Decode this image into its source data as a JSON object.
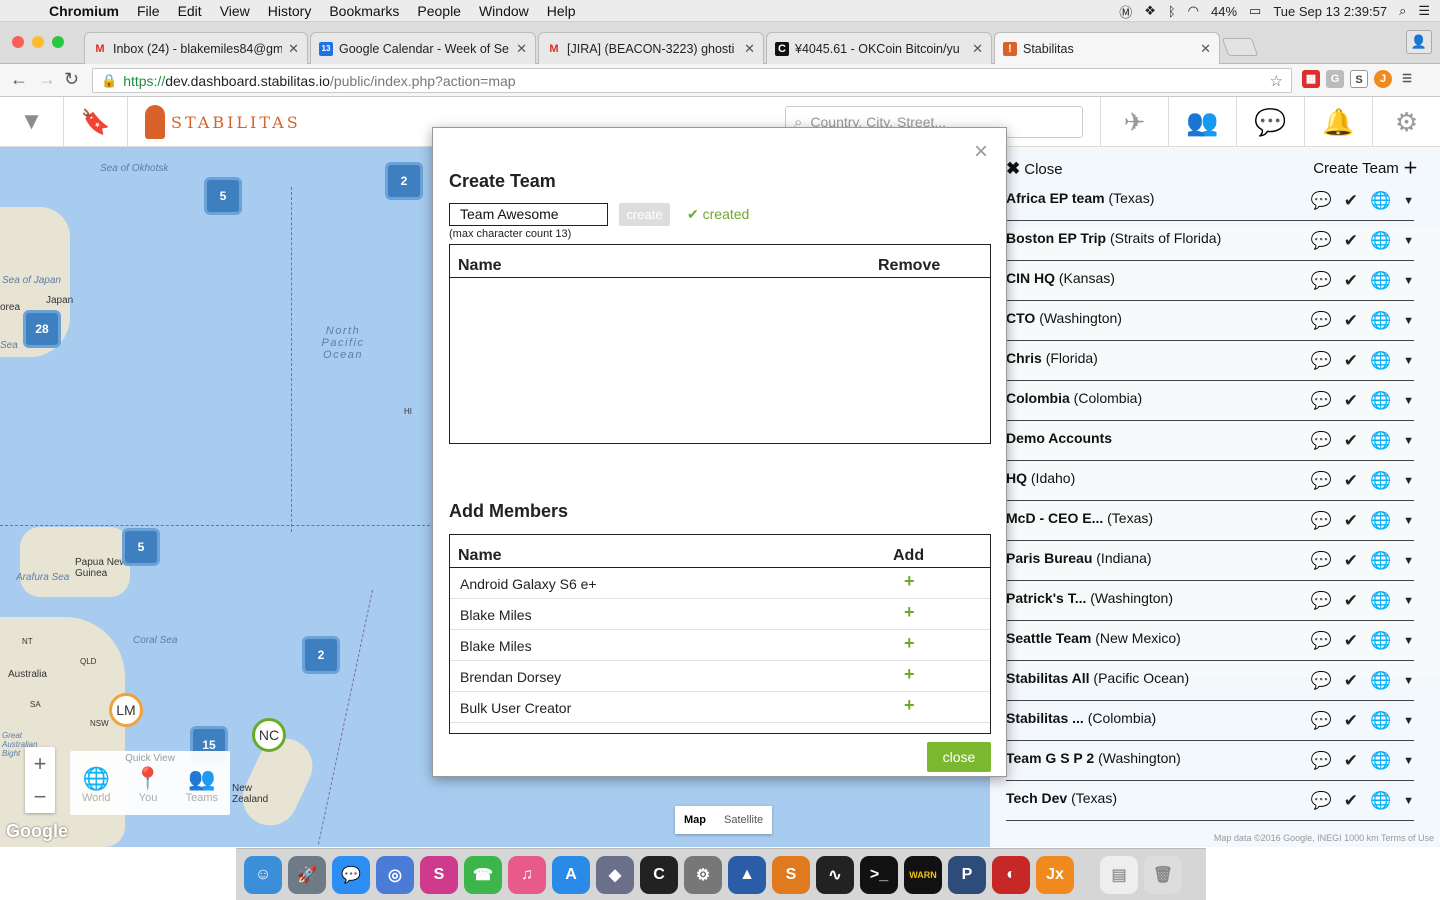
{
  "menubar": {
    "app": "Chromium",
    "items": [
      "File",
      "Edit",
      "View",
      "History",
      "Bookmarks",
      "People",
      "Window",
      "Help"
    ],
    "battery": "44%",
    "datetime": "Tue Sep 13  2:39:57"
  },
  "tabs": [
    {
      "title": "Inbox (24) - blakemiles84@gm",
      "icon": "gmail-icon",
      "fav": "M",
      "color": "#d93025"
    },
    {
      "title": "Google Calendar - Week of Se",
      "icon": "calendar-icon",
      "fav": "13",
      "color": "#1a73e8"
    },
    {
      "title": "[JIRA] (BEACON-3223) ghosti",
      "icon": "gmail-icon",
      "fav": "M",
      "color": "#d93025"
    },
    {
      "title": "¥4045.61 - OKCoin Bitcoin/yu",
      "icon": "okcoin-icon",
      "fav": "C",
      "color": "#111111"
    },
    {
      "title": "Stabilitas",
      "icon": "stabilitas-icon",
      "fav": "!",
      "color": "#d9622b"
    }
  ],
  "address": {
    "scheme": "https://",
    "host": "dev.dashboard.stabilitas.io",
    "path": "/public/index.php?action=map"
  },
  "header": {
    "brand": "STABILITAS",
    "search_placeholder": "Country, City, Street..."
  },
  "map": {
    "clusters": [
      "5",
      "2",
      "28",
      "5",
      "2",
      "15"
    ],
    "pins": [
      "LM",
      "NC"
    ],
    "labels": {
      "okhotsk": "Sea of Okhotsk",
      "japan_sea": "Sea of Japan",
      "japan": "Japan",
      "korea": "orea",
      "sea": "Sea",
      "pacific": "North Pacific Ocean",
      "hi": "HI",
      "png": "Papua New Guinea",
      "arafura": "Arafura Sea",
      "coral": "Coral Sea",
      "nt": "NT",
      "qld": "QLD",
      "australia": "Australia",
      "sa": "SA",
      "nsw": "NSW",
      "great": "Great Australian Bight",
      "nz": "New Zealand"
    },
    "quick_view": {
      "title": "Quick View",
      "items": [
        "World",
        "You",
        "Teams"
      ]
    },
    "google": "Google",
    "map_type": [
      "Map",
      "Satellite"
    ],
    "footer": "Map data ©2016 Google, INEGI   1000 km   Terms of Use"
  },
  "panel": {
    "close": "Close",
    "create_team": "Create Team",
    "teams": [
      {
        "name": "Africa EP team",
        "loc": "(Texas)"
      },
      {
        "name": "Boston EP Trip",
        "loc": "(Straits of Florida)"
      },
      {
        "name": "CIN HQ",
        "loc": "(Kansas)"
      },
      {
        "name": "CTO",
        "loc": "(Washington)"
      },
      {
        "name": "Chris",
        "loc": "(Florida)"
      },
      {
        "name": "Colombia",
        "loc": "(Colombia)"
      },
      {
        "name": "Demo Accounts",
        "loc": ""
      },
      {
        "name": "HQ",
        "loc": "(Idaho)"
      },
      {
        "name": "McD - CEO E...",
        "loc": "(Texas)"
      },
      {
        "name": "Paris Bureau",
        "loc": "(Indiana)"
      },
      {
        "name": "Patrick's T...",
        "loc": "(Washington)"
      },
      {
        "name": "Seattle Team",
        "loc": "(New Mexico)"
      },
      {
        "name": "Stabilitas All",
        "loc": "(Pacific Ocean)"
      },
      {
        "name": "Stabilitas ...",
        "loc": "(Colombia)"
      },
      {
        "name": "Team G S P 2",
        "loc": "(Washington)"
      },
      {
        "name": "Tech Dev",
        "loc": "(Texas)"
      }
    ]
  },
  "modal": {
    "title": "Create Team",
    "team_name_value": "Team Awesome",
    "create_label": "create",
    "created_label": "created",
    "max_note": "(max character count 13)",
    "team_table": {
      "col_name": "Name",
      "col_remove": "Remove"
    },
    "members_title": "Add Members",
    "members_table": {
      "col_name": "Name",
      "col_add": "Add"
    },
    "members": [
      "Android Galaxy S6 e+",
      "Blake Miles",
      "Blake Miles",
      "Brendan Dorsey",
      "Bulk User Creator"
    ],
    "close_label": "close"
  },
  "colors": {
    "accent": "#d9622b",
    "green": "#7cb82f",
    "cluster": "#3e7fc0"
  }
}
